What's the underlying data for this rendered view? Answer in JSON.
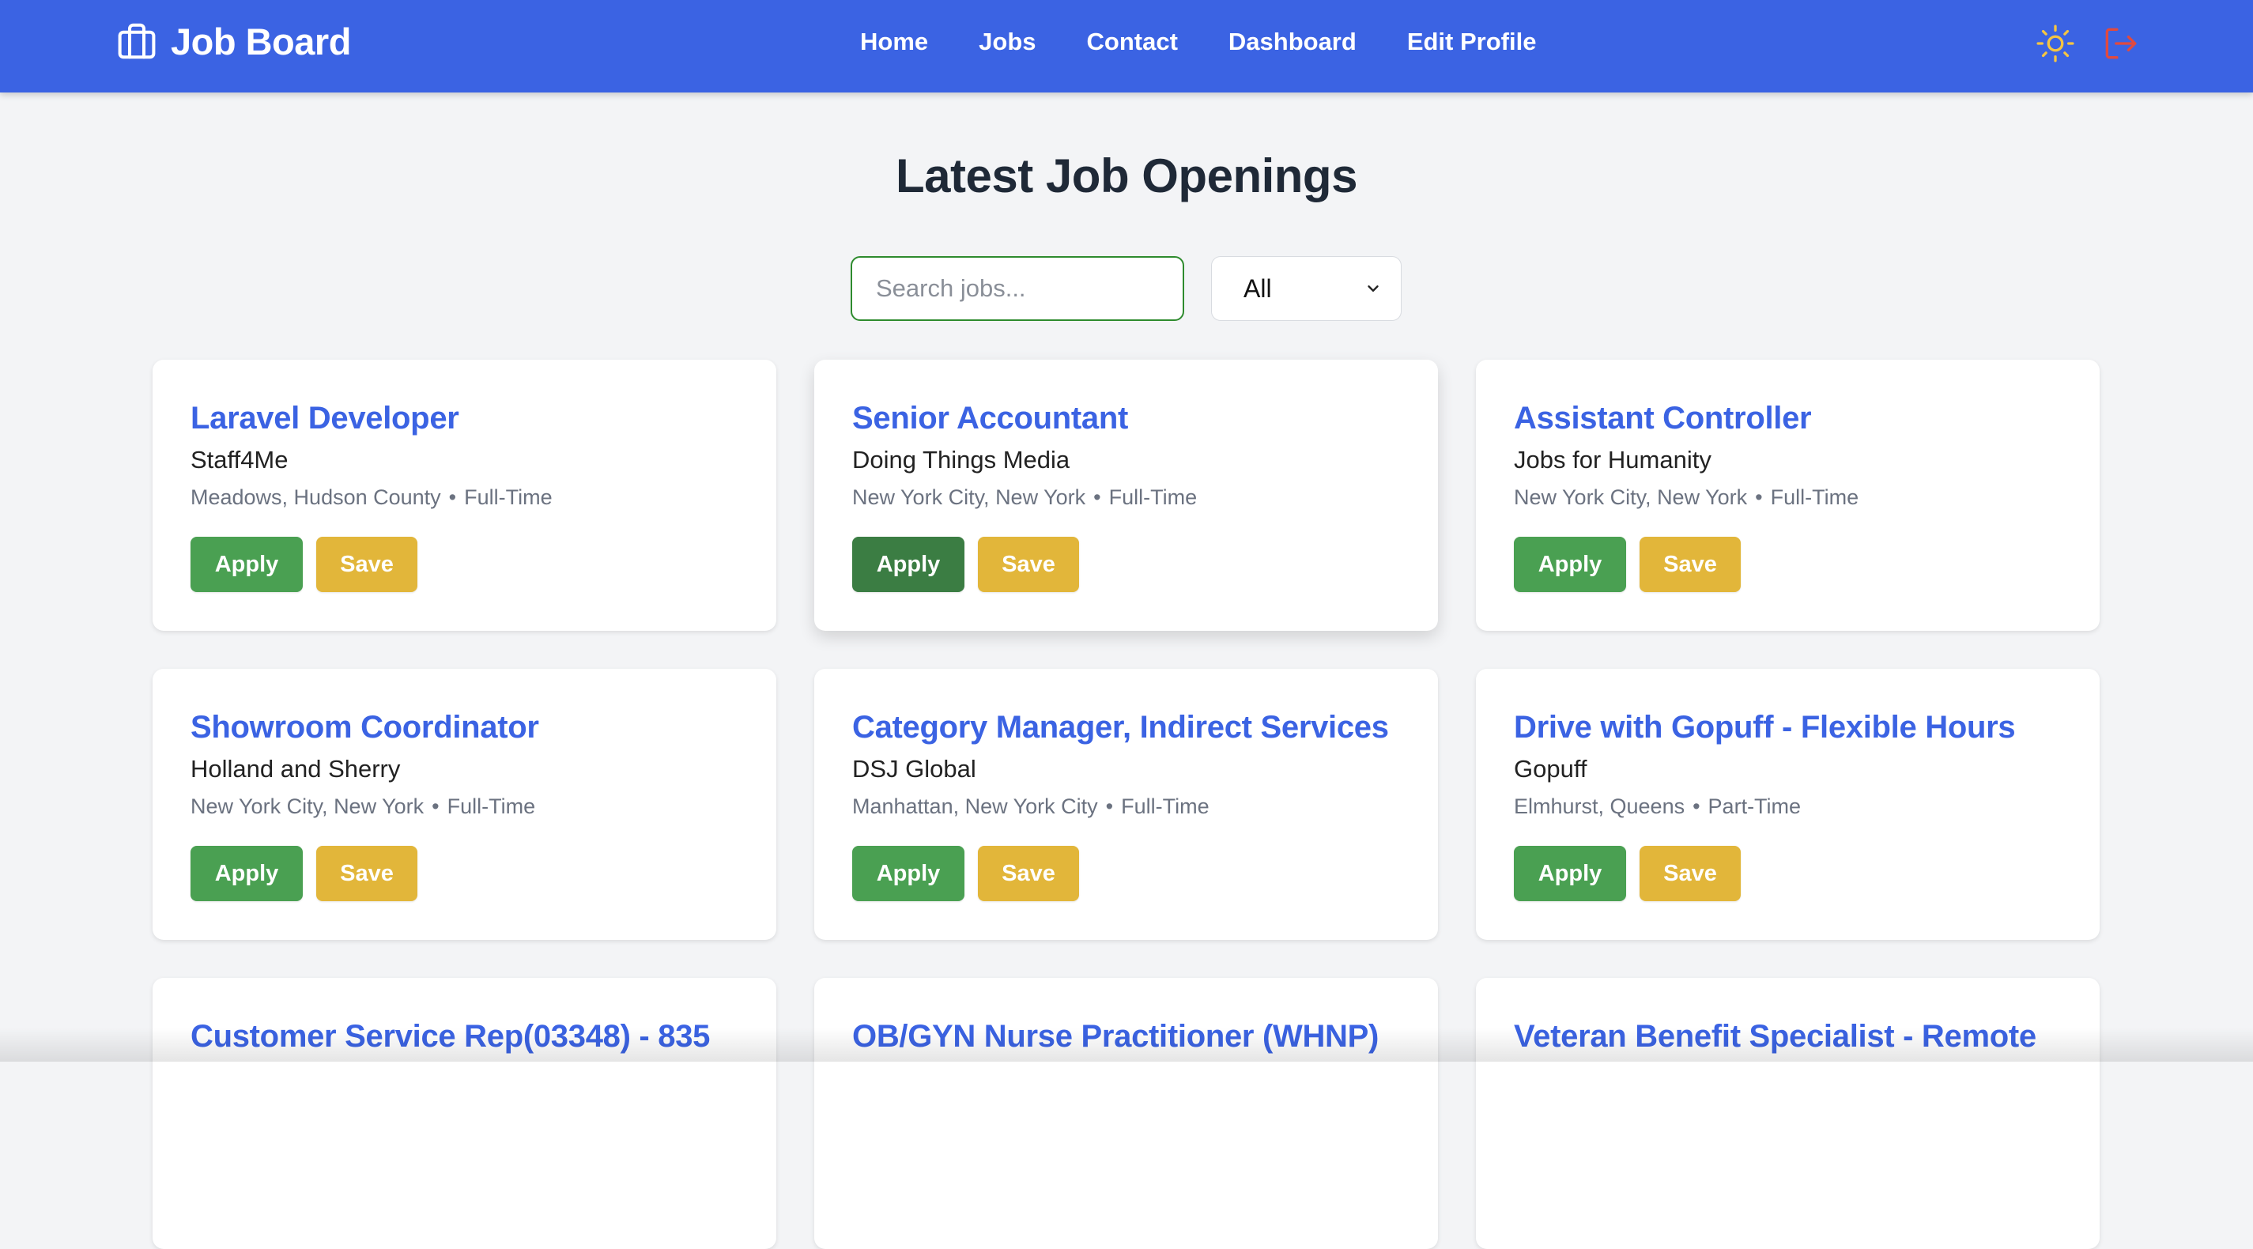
{
  "header": {
    "brand": "Job Board",
    "brand_icon": "briefcase-icon",
    "nav": [
      {
        "label": "Home"
      },
      {
        "label": "Jobs"
      },
      {
        "label": "Contact"
      },
      {
        "label": "Dashboard"
      },
      {
        "label": "Edit Profile"
      }
    ],
    "theme_icon": "sun-icon",
    "logout_icon": "logout-icon"
  },
  "page": {
    "title": "Latest Job Openings"
  },
  "search": {
    "placeholder": "Search jobs...",
    "value": ""
  },
  "filter": {
    "selected": "All"
  },
  "jobs": [
    {
      "title": "Laravel Developer",
      "company": "Staff4Me",
      "location": "Meadows, Hudson County",
      "type": "Full-Time",
      "apply": "Apply",
      "save": "Save"
    },
    {
      "title": "Senior Accountant",
      "company": "Doing Things Media",
      "location": "New York City, New York",
      "type": "Full-Time",
      "apply": "Apply",
      "save": "Save"
    },
    {
      "title": "Assistant Controller",
      "company": "Jobs for Humanity",
      "location": "New York City, New York",
      "type": "Full-Time",
      "apply": "Apply",
      "save": "Save"
    },
    {
      "title": "Showroom Coordinator",
      "company": "Holland and Sherry",
      "location": "New York City, New York",
      "type": "Full-Time",
      "apply": "Apply",
      "save": "Save"
    },
    {
      "title": "Category Manager, Indirect Services",
      "company": "DSJ Global",
      "location": "Manhattan, New York City",
      "type": "Full-Time",
      "apply": "Apply",
      "save": "Save"
    },
    {
      "title": "Drive with Gopuff - Flexible Hours",
      "company": "Gopuff",
      "location": "Elmhurst, Queens",
      "type": "Part-Time",
      "apply": "Apply",
      "save": "Save"
    },
    {
      "title": "Customer Service Rep(03348) - 835"
    },
    {
      "title": "OB/GYN Nurse Practitioner (WHNP)"
    },
    {
      "title": "Veteran Benefit Specialist - Remote"
    }
  ],
  "colors": {
    "header_bg": "#3b63e3",
    "title_blue": "#3b63e3",
    "apply_green": "#4aa052",
    "save_yellow": "#e2b63a",
    "logout_red": "#e04a3f",
    "sun_yellow": "#f5c542"
  }
}
